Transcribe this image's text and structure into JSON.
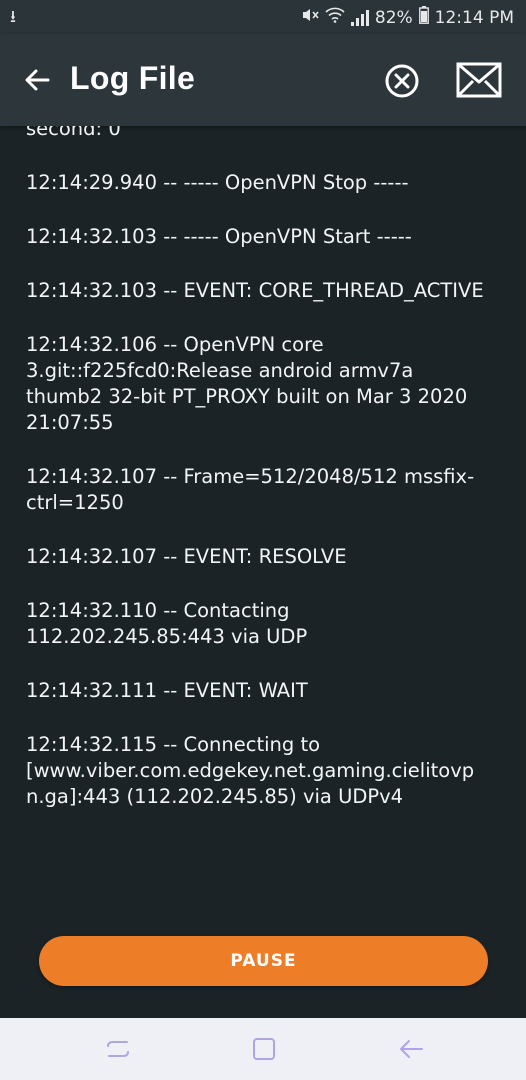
{
  "statusbar": {
    "battery": "82%",
    "time": "12:14 PM"
  },
  "appbar": {
    "title": "Log File"
  },
  "log": {
    "partial_line": "second: 0",
    "entries": [
      "12:14:29.940 -- ----- OpenVPN Stop -----",
      "12:14:32.103 -- ----- OpenVPN Start -----",
      "12:14:32.103 -- EVENT: CORE_THREAD_ACTIVE",
      "12:14:32.106 -- OpenVPN core 3.git::f225fcd0:Release android armv7a thumb2 32-bit PT_PROXY built on Mar  3 2020 21:07:55",
      "12:14:32.107 -- Frame=512/2048/512 mssfix-ctrl=1250",
      "12:14:32.107 -- EVENT: RESOLVE",
      "12:14:32.110 -- Contacting 112.202.245.85:443 via UDP",
      "12:14:32.111 -- EVENT: WAIT",
      "12:14:32.115 -- Connecting to [www.viber.com.edgekey.net.gaming.cielitovpn.ga]:443 (112.202.245.85) via UDPv4"
    ]
  },
  "actions": {
    "pause_label": "PAUSE"
  },
  "colors": {
    "accent": "#ee7d27",
    "background": "#1b2327",
    "appbar": "#2c363b",
    "navbar_icon": "#b0a4e6"
  }
}
